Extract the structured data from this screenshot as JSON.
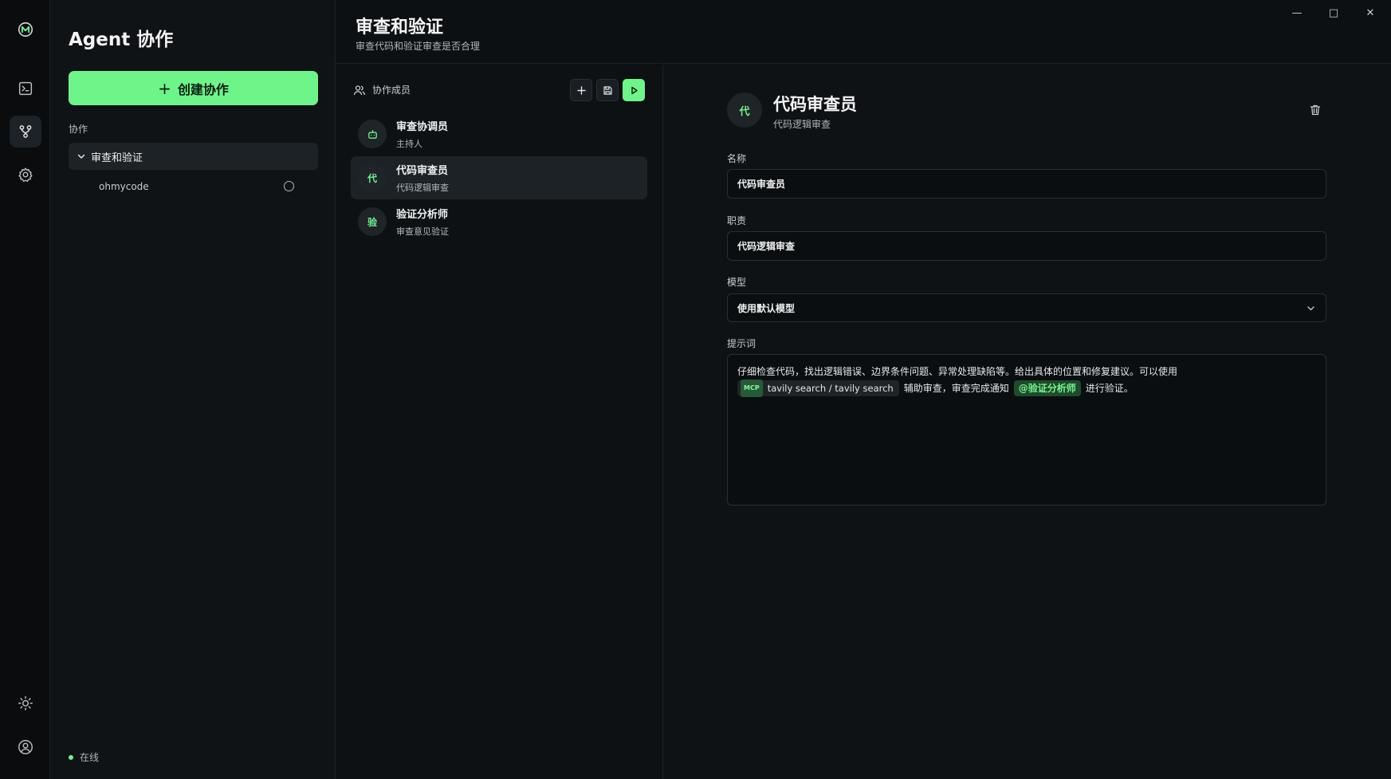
{
  "sidebar": {
    "title": "Agent 协作",
    "create_label": "创建协作",
    "section_label": "协作",
    "group": {
      "label": "审查和验证"
    },
    "sub_item": {
      "label": "ohmycode"
    },
    "status": {
      "label": "在线"
    }
  },
  "header": {
    "title": "审查和验证",
    "subtitle": "审查代码和验证审查是否合理"
  },
  "members": {
    "heading": "协作成员",
    "items": [
      {
        "avatar": "",
        "name": "审查协调员",
        "role": "主持人"
      },
      {
        "avatar": "代",
        "name": "代码审查员",
        "role": "代码逻辑审查"
      },
      {
        "avatar": "验",
        "name": "验证分析师",
        "role": "审查意见验证"
      }
    ]
  },
  "detail": {
    "avatar": "代",
    "name": "代码审查员",
    "role": "代码逻辑审查",
    "name_label": "名称",
    "name_value": "代码审查员",
    "duty_label": "职责",
    "duty_value": "代码逻辑审查",
    "model_label": "模型",
    "model_value": "使用默认模型",
    "prompt_label": "提示词",
    "prompt": {
      "line1": "仔细检查代码，找出逻辑错误、边界条件问题、异常处理缺陷等。给出具体的位置和修复建议。可以使用",
      "mcp_badge": "MCP",
      "mcp_tool": "tavily search / tavily search",
      "mid_text": "辅助审查，审查完成通知",
      "mention": "@验证分析师",
      "end_text": "进行验证。"
    }
  },
  "window": {
    "minimize": "—",
    "maximize": "□",
    "close": "✕"
  },
  "colors": {
    "accent": "#6ef58a",
    "background": "#0c0f12",
    "panel": "#101316",
    "selected": "#1d2226"
  }
}
